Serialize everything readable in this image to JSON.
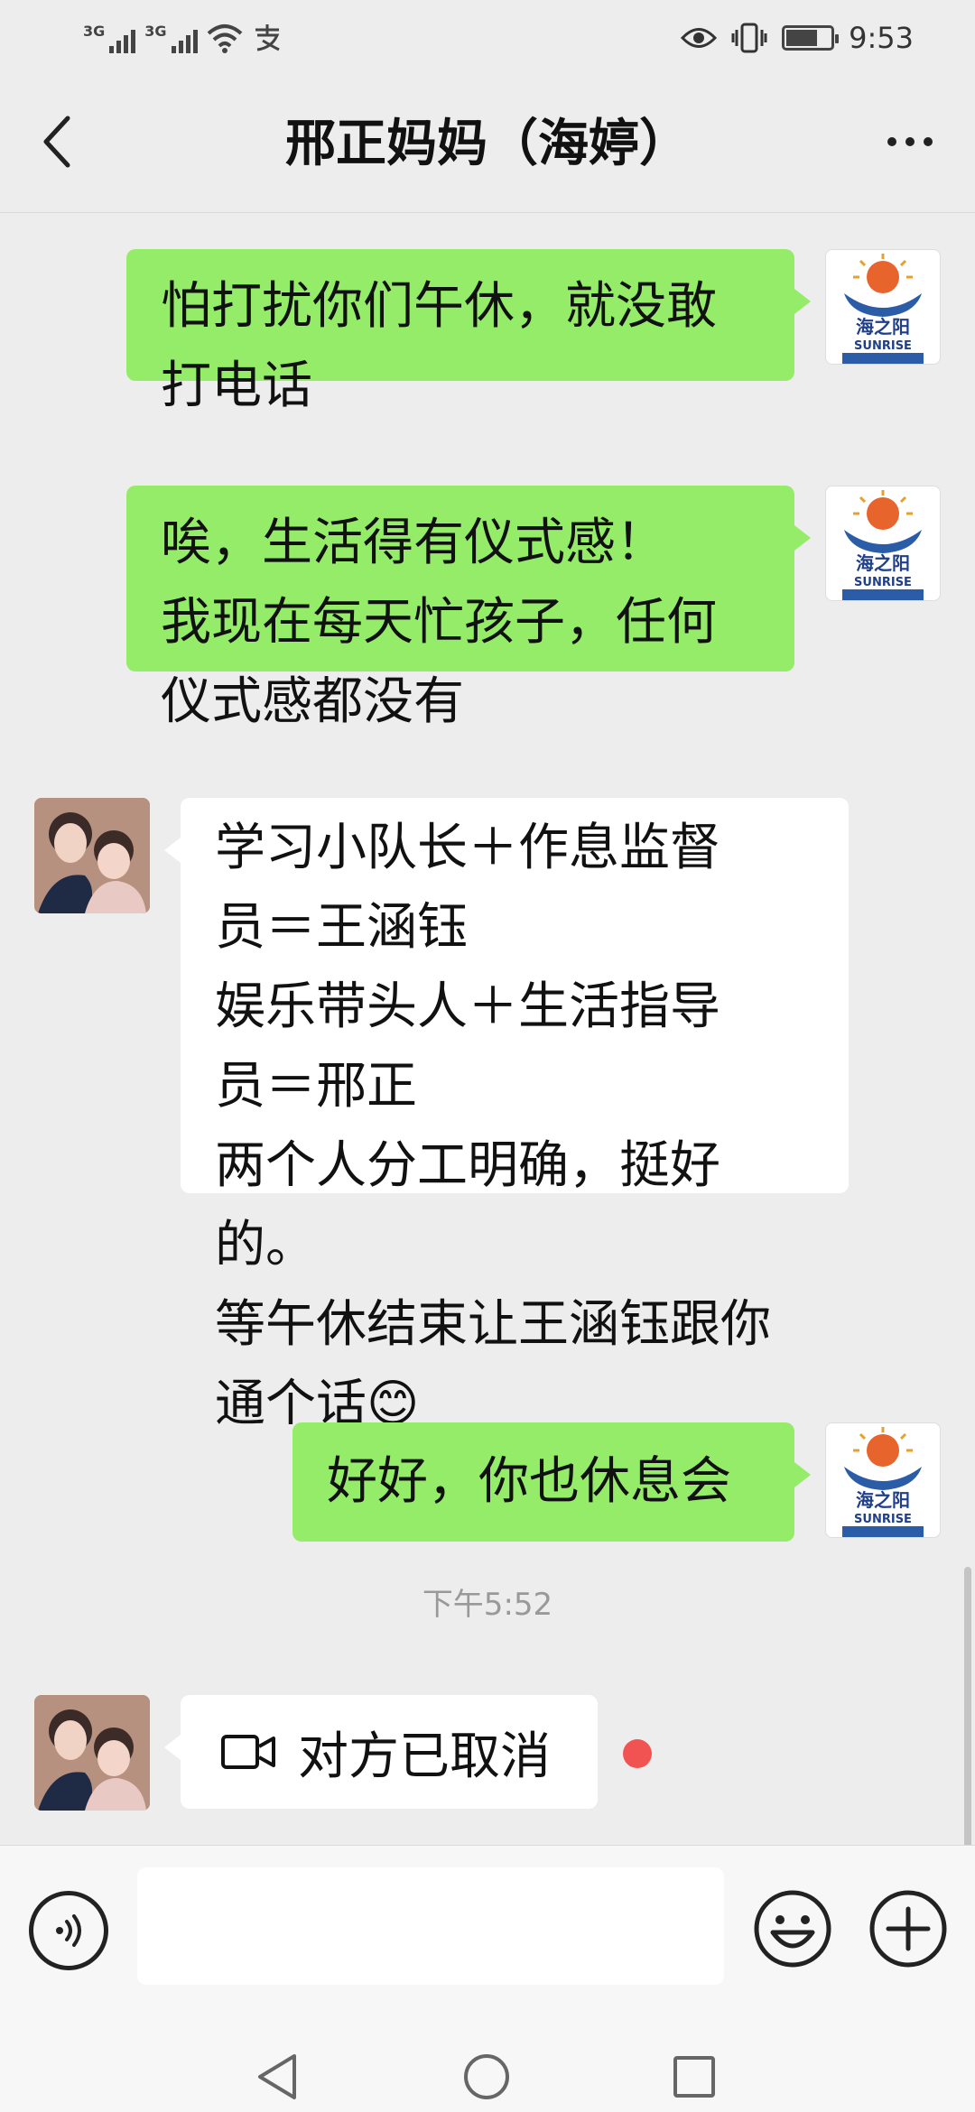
{
  "status_bar": {
    "network_1": "3G",
    "network_2": "3G",
    "time": "9:53",
    "battery_level": 0.65,
    "icons": [
      "signal-icon",
      "signal-icon",
      "wifi-icon",
      "alipay-icon",
      "eye-icon",
      "vibrate-icon",
      "battery-icon"
    ]
  },
  "header": {
    "title": "邢正妈妈（海婷）",
    "back_icon": "chevron-left-icon",
    "more_icon": "more-horizontal-icon"
  },
  "messages": [
    {
      "from": "me",
      "text": "怕打扰你们午休，就没敢\n打电话"
    },
    {
      "from": "me",
      "text": "唉，生活得有仪式感！\n我现在每天忙孩子，任何\n仪式感都没有"
    },
    {
      "from": "them",
      "text": "学习小队长＋作息监督\n员＝王涵钰\n娱乐带头人＋生活指导\n员＝邢正\n两个人分工明确，挺好的。\n等午休结束让王涵钰跟你\n通个话😊"
    },
    {
      "from": "me",
      "text": "好好，你也休息会"
    }
  ],
  "timestamp": "下午5:52",
  "call_message": {
    "icon": "video-camera-icon",
    "text": "对方已取消"
  },
  "my_avatar": {
    "logo_text": "海之阳",
    "logo_subtext": "SUNRISE"
  },
  "input_bar": {
    "placeholder": "",
    "voice_icon": "voice-icon",
    "emoji_icon": "emoji-icon",
    "plus_icon": "plus-icon"
  },
  "nav": {
    "back_icon": "nav-back-icon",
    "home_icon": "nav-home-icon",
    "recents_icon": "nav-recents-icon"
  },
  "colors": {
    "my_bubble": "#95ec69",
    "their_bubble": "#ffffff",
    "background": "#ededed",
    "unread_dot": "#f15353"
  }
}
